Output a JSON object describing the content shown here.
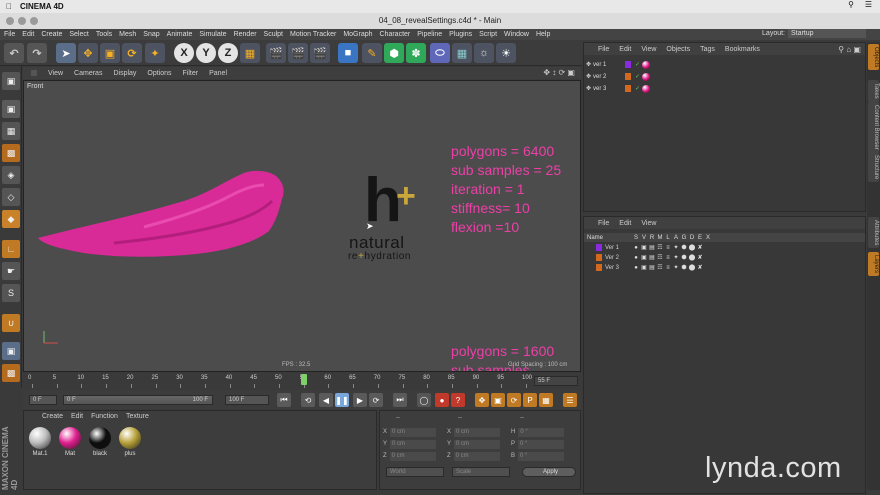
{
  "mac_menu": {
    "app": "CINEMA 4D"
  },
  "window_title": "04_08_revealSettings.c4d * - Main",
  "menubar": [
    "File",
    "Edit",
    "Create",
    "Select",
    "Tools",
    "Mesh",
    "Snap",
    "Animate",
    "Simulate",
    "Render",
    "Sculpt",
    "Motion Tracker",
    "MoGraph",
    "Character",
    "Pipeline",
    "Plugins",
    "Script",
    "Window",
    "Help"
  ],
  "layout": {
    "label": "Layout:",
    "value": "Startup"
  },
  "toolbar_letters": {
    "x": "X",
    "y": "Y",
    "z": "Z"
  },
  "viewport": {
    "menu": [
      "View",
      "Cameras",
      "Display",
      "Options",
      "Filter",
      "Panel"
    ],
    "label": "Front",
    "fps": "FPS : 32.5",
    "grid_spacing": "Grid Spacing : 100 cm",
    "info_top": [
      "polygons = 6400",
      "sub samples = 25",
      "iteration = 1",
      "stiffness= 10",
      "flexion =10"
    ],
    "info_bottom": [
      "polygons = 1600",
      "sub samples"
    ],
    "logo": {
      "h": "h",
      "plus": "+",
      "line1": "natural",
      "line2a": "re",
      "line2b": "hydration"
    }
  },
  "timeline": {
    "ticks": [
      "0",
      "5",
      "10",
      "15",
      "20",
      "25",
      "30",
      "35",
      "40",
      "45",
      "50",
      "55",
      "60",
      "65",
      "70",
      "75",
      "80",
      "85",
      "90",
      "95",
      "100"
    ],
    "current": "55 F",
    "playhead": 55
  },
  "transport": {
    "start": "0 F",
    "range_start": "0 F",
    "range_end": "100 F",
    "end": "100 F"
  },
  "materials": {
    "menu": [
      "Create",
      "Edit",
      "Function",
      "Texture"
    ],
    "items": [
      {
        "name": "Mat.1",
        "color": "#bdbdbd"
      },
      {
        "name": "Mat",
        "color": "#e0208f"
      },
      {
        "name": "black",
        "color": "#0d0d0d"
      },
      {
        "name": "plus",
        "color": "#b8a23a"
      }
    ]
  },
  "coordinates": {
    "header": [
      "--",
      "--",
      "--"
    ],
    "rows": [
      {
        "a": "X",
        "av": "0 cm",
        "b": "X",
        "bv": "0 cm",
        "c": "H",
        "cv": "0 °"
      },
      {
        "a": "Y",
        "av": "0 cm",
        "b": "Y",
        "bv": "0 cm",
        "c": "P",
        "cv": "0 °"
      },
      {
        "a": "Z",
        "av": "0 cm",
        "b": "Z",
        "bv": "0 cm",
        "c": "B",
        "cv": "0 °"
      }
    ],
    "mode1": "World",
    "mode2": "Scale",
    "apply": "Apply"
  },
  "objects": {
    "menu": [
      "File",
      "Edit",
      "View",
      "Objects",
      "Tags",
      "Bookmarks"
    ],
    "items": [
      {
        "name": "ver 1",
        "color": "#8a2be2"
      },
      {
        "name": "ver 2",
        "color": "#d2691e"
      },
      {
        "name": "ver 3",
        "color": "#d2691e"
      }
    ]
  },
  "layers": {
    "menu": [
      "File",
      "Edit",
      "View"
    ],
    "columns": [
      "Name",
      "S",
      "V",
      "R",
      "M",
      "L",
      "A",
      "G",
      "D",
      "E",
      "X"
    ],
    "items": [
      {
        "name": "Ver 1",
        "color": "#8a2be2"
      },
      {
        "name": "Ver 2",
        "color": "#d2691e"
      },
      {
        "name": "Ver 3",
        "color": "#d2691e"
      }
    ]
  },
  "side_tabs": [
    "Objects",
    "Takes",
    "Content Browser",
    "Structure",
    "Attributes",
    "Layers"
  ],
  "branding": {
    "maxon": "MAXON CINEMA 4D",
    "lynda": "lynda.com"
  }
}
